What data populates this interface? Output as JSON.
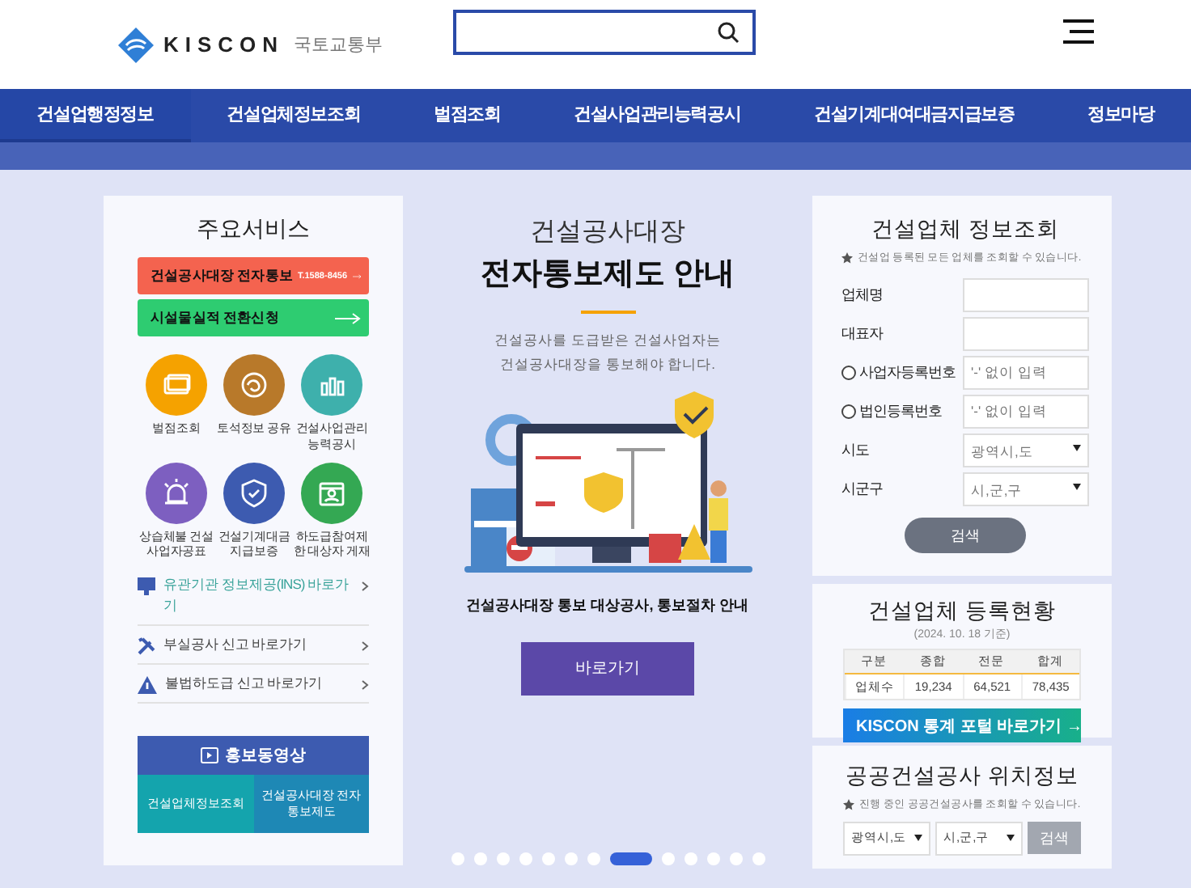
{
  "header": {
    "logo_text": "KISCON",
    "ministry": "국토교통부"
  },
  "nav": [
    {
      "label": "건설업행정정보",
      "selected": true
    },
    {
      "label": "건설업체정보조회",
      "selected": false
    },
    {
      "label": "벌점조회",
      "selected": false
    },
    {
      "label": "건설사업관리능력공시",
      "selected": false
    },
    {
      "label": "건설기계대여대금지급보증",
      "selected": false
    },
    {
      "label": "정보마당",
      "selected": false
    }
  ],
  "services": {
    "title": "주요서비스",
    "banners": [
      {
        "label": "건설공사대장 전자통보",
        "phone": "T.1588-8456",
        "color": "#f4634f"
      },
      {
        "label": "시설물실적 전환신청",
        "color": "#2ecc71"
      }
    ],
    "icons": [
      {
        "kind": "cards",
        "label": "벌점조회",
        "color": "#f5a200"
      },
      {
        "kind": "swirl",
        "label": "토석정보 공유",
        "color": "#b8792a"
      },
      {
        "kind": "chart",
        "label": "건설사업관리 능력공시",
        "color": "#3eb0ac"
      },
      {
        "kind": "alarm",
        "label": "상습체불 건설사업자공표",
        "color": "#7d5fc0"
      },
      {
        "kind": "shield",
        "label": "건설기계대금 지급보증",
        "color": "#3d5bb0"
      },
      {
        "kind": "calendar",
        "label": "하도급참여제한 대상자 게재",
        "color": "#34a853"
      }
    ],
    "links": [
      {
        "kind": "monitor",
        "label": "유관기관 정보제공(INS) 바로가기"
      },
      {
        "kind": "tools",
        "label": "부실공사 신고 바로가기"
      },
      {
        "kind": "warning",
        "label": "불법하도급 신고 바로가기"
      }
    ],
    "video": {
      "title": "홍보동영상",
      "buttons": [
        "건설업체정보조회",
        "건설공사대장 전자통보제도"
      ]
    }
  },
  "notice": {
    "title": "건설공사대장",
    "headline": "전자통보제도 안내",
    "description": [
      "건설공사를 도급받은 건설사업자는",
      "건설공사대장을 통보해야 합니다."
    ],
    "caption": "건설공사대장 통보 대상공사, 통보절차 안내",
    "button": "바로가기",
    "dots": [
      {
        "selected": false
      },
      {
        "selected": false
      },
      {
        "selected": false
      },
      {
        "selected": false
      },
      {
        "selected": false
      },
      {
        "selected": false
      },
      {
        "selected": false
      },
      {
        "selected": true
      },
      {
        "selected": false
      },
      {
        "selected": false
      },
      {
        "selected": false
      },
      {
        "selected": false
      },
      {
        "selected": false
      }
    ]
  },
  "company_search": {
    "title": "건설업체 정보조회",
    "note": "건설업 등록된 모든 업체를 조회할 수 있습니다.",
    "fields": [
      {
        "kind": "text",
        "label": "업체명"
      },
      {
        "kind": "text",
        "label": "대표자"
      },
      {
        "kind": "radio",
        "label": "사업자등록번호",
        "placeholder": "'-' 없이 입력",
        "checked": false
      },
      {
        "kind": "radio",
        "label": "법인등록번호",
        "placeholder": "'-' 없이 입력",
        "checked": false
      },
      {
        "kind": "select",
        "label": "시도",
        "value": "광역시,도"
      },
      {
        "kind": "select",
        "label": "시군구",
        "value": "시,군,구"
      }
    ],
    "button": "검색"
  },
  "registration": {
    "title": "건설업체 등록현황",
    "date": "(2024. 10. 18 기준)",
    "columns": [
      "구분",
      "종합",
      "전문",
      "합계"
    ],
    "rows": [
      [
        "업체수",
        "19,234",
        "64,521",
        "78,435"
      ]
    ],
    "portal_link": "KISCON 통계 포털 바로가기 →"
  },
  "location": {
    "title": "공공건설공사 위치정보",
    "note": "진행 중인 공공건설공사를 조회할 수 있습니다.",
    "selects": [
      "광역시,도",
      "시,군,구"
    ],
    "button": "검색"
  }
}
